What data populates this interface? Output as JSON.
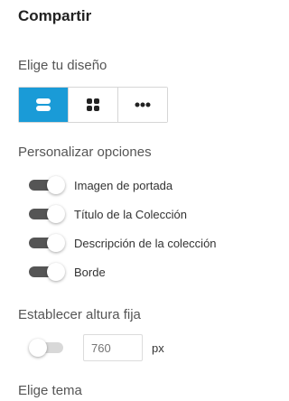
{
  "panel": {
    "title": "Compartir"
  },
  "layout": {
    "label": "Elige tu diseño",
    "options": [
      {
        "icon": "stacked-rows-icon",
        "active": true
      },
      {
        "icon": "grid-icon",
        "active": false
      },
      {
        "icon": "more-dots-icon",
        "active": false
      }
    ],
    "accent_color": "#1a9bd7"
  },
  "options": {
    "label": "Personalizar opciones",
    "toggles": [
      {
        "label": "Imagen de portada",
        "on": true
      },
      {
        "label": "Título de la Colección",
        "on": true
      },
      {
        "label": "Descripción de la colección",
        "on": true
      },
      {
        "label": "Borde",
        "on": true
      }
    ]
  },
  "fixed_height": {
    "label": "Establecer altura fija",
    "enabled": false,
    "value_placeholder": "760",
    "unit": "px"
  },
  "theme": {
    "label": "Elige tema"
  }
}
